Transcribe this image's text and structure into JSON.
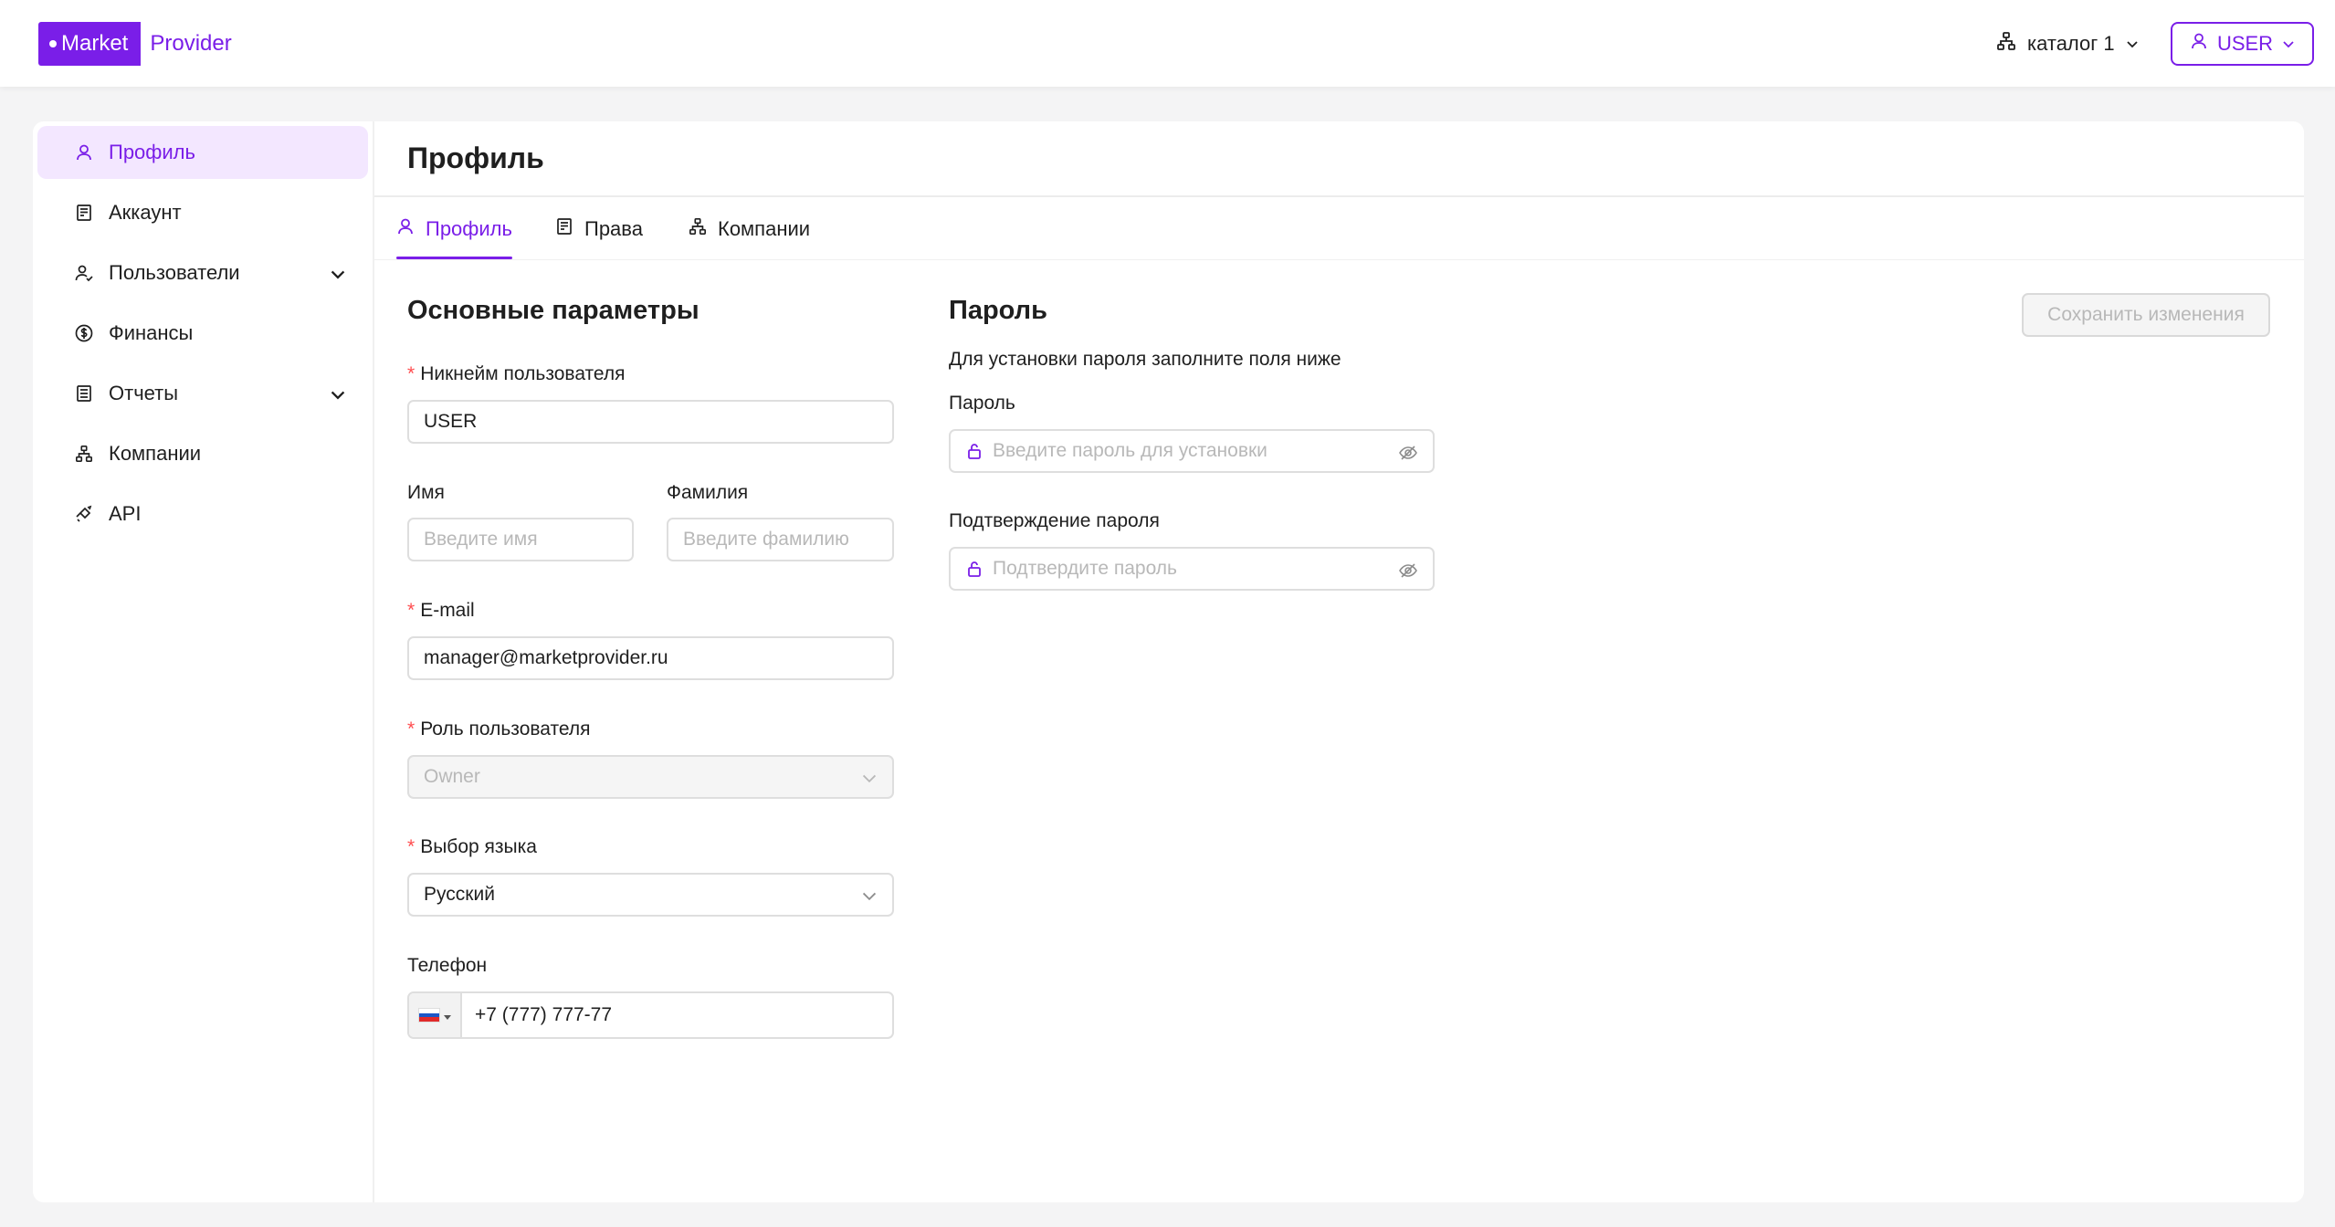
{
  "header": {
    "logo_left": "Market",
    "logo_right": "Provider",
    "catalog_label": "каталог 1",
    "user_label": "USER"
  },
  "sidebar": {
    "items": [
      {
        "label": "Профиль",
        "icon": "user-icon"
      },
      {
        "label": "Аккаунт",
        "icon": "receipt-icon"
      },
      {
        "label": "Пользователи",
        "icon": "users-icon"
      },
      {
        "label": "Финансы",
        "icon": "dollar-icon"
      },
      {
        "label": "Отчеты",
        "icon": "report-icon"
      },
      {
        "label": "Компании",
        "icon": "hierarchy-icon"
      },
      {
        "label": "API",
        "icon": "api-icon"
      }
    ]
  },
  "page": {
    "title": "Профиль",
    "tabs": [
      {
        "label": "Профиль"
      },
      {
        "label": "Права"
      },
      {
        "label": "Компании"
      }
    ]
  },
  "basic": {
    "section_title": "Основные параметры",
    "nickname_label": "Никнейм пользователя",
    "nickname_value": "USER",
    "first_name_label": "Имя",
    "first_name_placeholder": "Введите имя",
    "last_name_label": "Фамилия",
    "last_name_placeholder": "Введите фамилию",
    "email_label": "E-mail",
    "email_value": "manager@marketprovider.ru",
    "role_label": "Роль пользователя",
    "role_value": "Owner",
    "language_label": "Выбор языка",
    "language_value": "Русский",
    "phone_label": "Телефон",
    "phone_value": "+7 (777) 777-77",
    "required_mark": "*"
  },
  "password": {
    "section_title": "Пароль",
    "hint": "Для установки пароля заполните поля ниже",
    "password_label": "Пароль",
    "password_placeholder": "Введите пароль для установки",
    "confirm_label": "Подтверждение пароля",
    "confirm_placeholder": "Подтвердите пароль",
    "save_button": "Сохранить изменения"
  },
  "colors": {
    "accent": "#7a1ee8",
    "accent_light": "#f3e7ff",
    "required": "#ff4d4f"
  }
}
